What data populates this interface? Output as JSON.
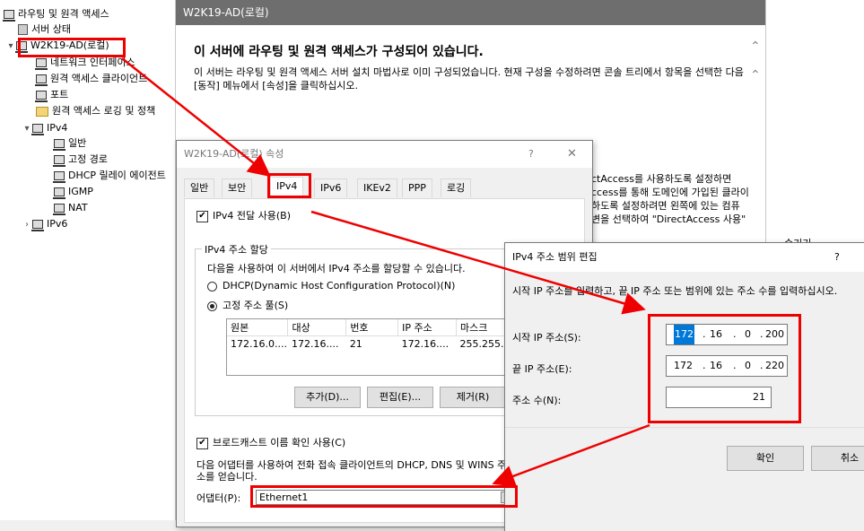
{
  "tree": {
    "items": [
      {
        "label": "라우팅 및 원격 액세스",
        "icon": "server-icon",
        "indent": 0,
        "expander": ""
      },
      {
        "label": "서버 상태",
        "icon": "database-icon",
        "indent": 1,
        "expander": ""
      },
      {
        "label": "W2K19-AD(로컬)",
        "icon": "server-icon",
        "indent": 1,
        "expander": "▾"
      },
      {
        "label": "네트워크 인터페이스",
        "icon": "server-icon",
        "indent": 2,
        "expander": ""
      },
      {
        "label": "원격 액세스 클라이언트",
        "icon": "server-icon",
        "indent": 2,
        "expander": ""
      },
      {
        "label": "포트",
        "icon": "server-icon",
        "indent": 2,
        "expander": ""
      },
      {
        "label": "원격 액세스 로깅 및 정책",
        "icon": "folder-icon",
        "indent": 2,
        "expander": ""
      },
      {
        "label": "IPv4",
        "icon": "server-icon",
        "indent": 2,
        "expander": "▾"
      },
      {
        "label": "일반",
        "icon": "server-icon",
        "indent": 3,
        "expander": ""
      },
      {
        "label": "고정 경로",
        "icon": "server-icon",
        "indent": 3,
        "expander": ""
      },
      {
        "label": "DHCP 릴레이 에이전트",
        "icon": "server-icon",
        "indent": 3,
        "expander": ""
      },
      {
        "label": "IGMP",
        "icon": "server-icon",
        "indent": 3,
        "expander": ""
      },
      {
        "label": "NAT",
        "icon": "server-icon",
        "indent": 3,
        "expander": ""
      },
      {
        "label": "IPv6",
        "icon": "server-icon",
        "indent": 2,
        "expander": "›"
      }
    ]
  },
  "main": {
    "header": "W2K19-AD(로컬)",
    "heading": "이 서버에 라우팅 및 원격 액세스가 구성되어 있습니다.",
    "description": "이 서버는 라우팅 및 원격 액세스 서버 설치 마법사로 이미 구성되었습니다. 현재 구성을 수정하려면 콘솔 트리에서 항목을 선택한 다음 [동작] 메뉴에서 [속성]을 클릭하십시오.",
    "partial_lines": [
      "ctAccess를 사용하도록 설정하면",
      "ccess를 통해 도메인에 가입된 클라이",
      "하도록 설정하려면 왼쪽에 있는 컴퓨",
      "변을 선택하여 \"DirectAccess 사용\""
    ],
    "right_partial": "숨기기"
  },
  "properties": {
    "title": "W2K19-AD(로컬) 속성",
    "help": "?",
    "close": "✕",
    "tabs": [
      "일반",
      "보안",
      "IPv4",
      "IPv6",
      "IKEv2",
      "PPP",
      "로깅"
    ],
    "forwarding_label": "IPv4 전달 사용(B)",
    "group_title": "IPv4 주소 할당",
    "group_desc": "다음을 사용하여 이 서버에서 IPv4 주소를 할당할 수 있습니다.",
    "radio_dhcp": "DHCP(Dynamic Host Configuration Protocol)(N)",
    "radio_static": "고정 주소 풀(S)",
    "table_headers": [
      "원본",
      "대상",
      "번호",
      "IP 주소",
      "마스크"
    ],
    "table_row": [
      "172.16.0....",
      "172.16....",
      "21",
      "172.16....",
      "255.255...."
    ],
    "btn_add": "추가(D)...",
    "btn_edit": "편집(E)...",
    "btn_remove": "제거(R)",
    "broadcast_label": "브로드캐스트 이름 확인 사용(C)",
    "adapter_desc": "다음 어댑터를 사용하여 전화 접속 클라이언트의 DHCP, DNS 및 WINS 주소를 얻습니다.",
    "adapter_label": "어댑터(P):",
    "adapter_value": "Ethernet1"
  },
  "range": {
    "title": "IPv4 주소 범위 편집",
    "help": "?",
    "instruction": "시작 IP 주소를 입력하고, 끝 IP 주소 또는 범위에 있는 주소 수를 입력하십시오.",
    "start_label": "시작 IP 주소(S):",
    "start_ip": [
      "172",
      "16",
      "0",
      "200"
    ],
    "end_label": "끝 IP 주소(E):",
    "end_ip": [
      "172",
      "16",
      "0",
      "220"
    ],
    "count_label": "주소 수(N):",
    "count_value": "21",
    "ok": "확인",
    "cancel": "취소"
  },
  "colors": {
    "highlight": "#e00000",
    "selection": "#0078d7"
  }
}
